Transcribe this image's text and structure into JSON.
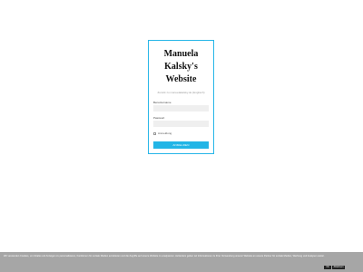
{
  "login": {
    "site_title_line1": "Manuela",
    "site_title_line2": "Kalsky's",
    "site_title_line3": "Website",
    "language_link": "Zurück zu manuelakalsky.de (Englisch)",
    "username_label": "Benutzername",
    "password_label": "Passwort",
    "remember_label": "Anmeldung",
    "submit_label": "ANMELDEN"
  },
  "cookie_bar": {
    "text": "Wir verwenden Cookies, um Inhalte und Anzeigen zu personalisieren, Funktionen für soziale Medien anzubieten und die Zugriffe auf unsere Website zu analysieren. Außerdem geben wir Informationen zu Ihrer Verwendung unserer Website an unsere Partner für soziale Medien, Werbung und Analysen weiter.",
    "ok_label": "Ok",
    "decline_label": "Ablehnen"
  },
  "colors": {
    "accent": "#22b5e6",
    "card_border": "#27b6e8",
    "cookie_bar": "#a6a6a6"
  }
}
